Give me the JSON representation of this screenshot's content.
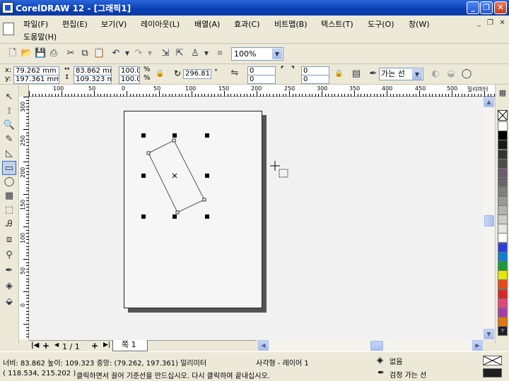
{
  "window": {
    "title": "CorelDRAW 12 - [그래픽1]"
  },
  "menu": {
    "items": [
      "파일(F)",
      "편집(E)",
      "보기(V)",
      "레이아웃(L)",
      "배열(A)",
      "효과(C)",
      "비트맵(B)",
      "텍스트(T)",
      "도구(O)",
      "창(W)",
      "도움말(H)"
    ]
  },
  "standard_toolbar": {
    "icons": [
      "new-icon",
      "open-icon",
      "save-icon",
      "print-icon",
      "cut-icon",
      "copy-icon",
      "paste-icon",
      "undo-icon",
      "redo-icon",
      "import-icon",
      "export-icon",
      "launcher-icon",
      "snap-icon"
    ],
    "zoom_value": "100%"
  },
  "property_bar": {
    "x_label": "x:",
    "x_value": "79.262 mm",
    "y_label": "y:",
    "y_value": "197.361 mm",
    "width_value": "83.862 mm",
    "height_value": "109.323 mm",
    "scale_x": "100.0",
    "scale_y": "100.0",
    "percent": "%",
    "rotation_value": "296.811",
    "degree": "°",
    "corner_tl": "0",
    "corner_tr": "0",
    "corner_bl": "0",
    "corner_br": "0",
    "outline_value": "가는 선"
  },
  "toolbox": {
    "tools": [
      "pick-tool",
      "shape-tool",
      "zoom-tool",
      "freehand-tool",
      "smart-fill-tool",
      "rectangle-tool",
      "ellipse-tool",
      "graph-paper-tool",
      "basic-shapes-tool",
      "text-tool",
      "interactive-blend-tool",
      "eyedropper-tool",
      "outline-tool",
      "fill-tool",
      "interactive-fill-tool"
    ],
    "active": "rectangle-tool"
  },
  "rulers": {
    "horizontal": [
      "100",
      "50",
      "0",
      "50",
      "100",
      "150",
      "200",
      "250",
      "300",
      "350",
      "400",
      "450",
      "500",
      "밀리미터"
    ],
    "vertical": [
      "300",
      "250",
      "200",
      "150",
      "100",
      "50",
      "0"
    ]
  },
  "page_nav": {
    "page_count": "1 / 1",
    "tab_label": "쪽 1"
  },
  "palette": {
    "colors": [
      "#ffffff",
      "#000000",
      "#1a1a1a",
      "#333333",
      "#4d4d4d",
      "#6b5b6e",
      "#666666",
      "#808080",
      "#999999",
      "#b3b3b3",
      "#cccccc",
      "#e6e6e6",
      "#ffffff",
      "#2b3fd6",
      "#0f7fd0",
      "#1a9a3a",
      "#e6e600",
      "#e64a19",
      "#d62828",
      "#e0457b",
      "#a63da8",
      "#e07a10",
      "#1f1f1f"
    ]
  },
  "status": {
    "dimensions": "너비: 83.862  높이: 109.323  중앙: (79.262, 197.361)  밀리미터",
    "object_info": "사각형 - 레이어 1",
    "fill_label": "없음",
    "cursor_position": "( 118.534, 215.202 )",
    "hint": "클릭하면서 끌어 기준선을 만드십시오. 다시 클릭하여 끝내십시오.",
    "outline_label": "검정  가는 선"
  }
}
